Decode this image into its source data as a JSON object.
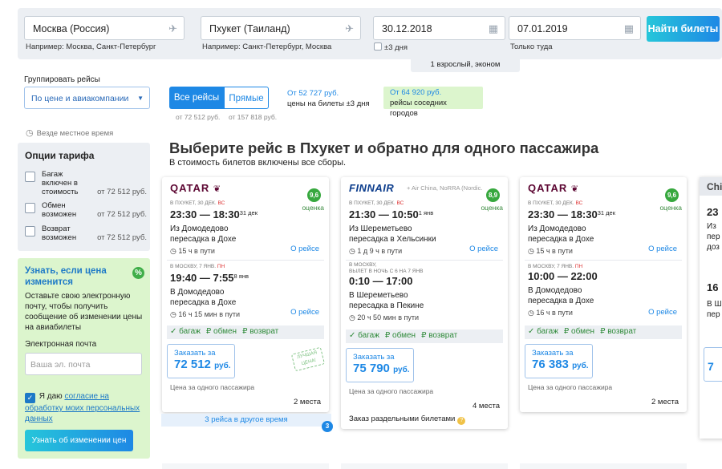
{
  "search": {
    "origin": "Москва (Россия)",
    "origin_hint": "Например: Москва, Санкт-Петербург",
    "destination": "Пхукет (Таиланд)",
    "destination_hint": "Например: Санкт-Петербург, Москва",
    "depart_date": "30.12.2018",
    "flex_label": "±3 дня",
    "return_date": "07.01.2019",
    "return_hint": "Только туда",
    "find_button": "Найти билеты",
    "passengers": "1 взрослый, эконом"
  },
  "left": {
    "group_label": "Группировать рейсы",
    "group_value": "По цене и авиакомпании",
    "local_time": "Везде местное время",
    "tariff_title": "Опции тарифа",
    "tariff_options": [
      {
        "label": "Багаж включен в стоимость",
        "price": "от 72 512 руб."
      },
      {
        "label": "Обмен возможен",
        "price": "от 72 512 руб."
      },
      {
        "label": "Возврат возможен",
        "price": "от 72 512 руб."
      }
    ],
    "notify_title": "Узнать, если цена изменится",
    "notify_badge": "%",
    "notify_text": "Оставьте свою электронную почту, чтобы получить сообщение об изменении цены на авиабилеты",
    "email_label": "Электронная почта",
    "email_placeholder": "Ваша эл. почта",
    "agree_prefix": "Я даю",
    "agree_link": "согласие на обработку моих персональных данных",
    "notify_button": "Узнать об изменении цен"
  },
  "filters": {
    "all_label": "Все рейсы",
    "direct_label": "Прямые",
    "all_price": "от 72 512 руб.",
    "direct_price": "от 157 818 руб.",
    "flex_price": "От 52 727 руб.",
    "flex_text": "цены на билеты ±3 дня",
    "nearby_price": "От 64 920 руб.",
    "nearby_text": "рейсы соседних городов"
  },
  "headline": "Выберите рейс в Пхукет и обратно для одного пассажира",
  "subline": "В стоимость билетов включены все сборы.",
  "perks": {
    "baggage": "✓ багаж",
    "exchange": "₽ обмен",
    "refund": "₽ возврат"
  },
  "order_label": "Заказать за",
  "per_pax": "Цена за одного пассажира",
  "about": "О рейсе",
  "score_label": "оценка",
  "best_price_stamp": "ЛУЧШАЯ ЦЕНА!",
  "more_flights": "3 рейса в другое время",
  "more_count": "3",
  "cards": [
    {
      "airline": "QATAR",
      "extra": "",
      "score": "9,6",
      "out": {
        "dir": "В Пхукет, 30 дек.",
        "dow": "ВС",
        "times": "23:30 — 18:30",
        "next": "31 дек",
        "from": "Из Домодедово",
        "via": "пересадка в Дохе",
        "dur": "15 ч в пути"
      },
      "back": {
        "dir": "В Москву, 7 янв.",
        "dow": "ПН",
        "times": "19:40 — 7:55",
        "next": "8 янв",
        "from": "В Домодедово",
        "via": "пересадка в Дохе",
        "dur": "16 ч 15 мин в пути"
      },
      "price": "72 512",
      "currency": "руб.",
      "places": "2 места"
    },
    {
      "airline": "FINNAIR",
      "extra": "+ Air China, NoRRA (Nordic...",
      "score": "8,9",
      "out": {
        "dir": "В Пхукет, 30 дек.",
        "dow": "ВС",
        "times": "21:30 — 10:50",
        "next": "1 янв",
        "from": "Из Шереметьево",
        "via": "пересадка в Хельсинки",
        "dur": "1 д 9 ч в пути"
      },
      "back": {
        "dir": "В Москву,",
        "dir2": "вылет в ночь с 6 на 7 янв",
        "dow": "",
        "times": "0:10 — 17:00",
        "next": "",
        "from": "В Шереметьево",
        "via": "пересадка в Пекине",
        "dur": "20 ч 50 мин в пути"
      },
      "price": "75 790",
      "currency": "руб.",
      "places": "4 места",
      "separate": "Заказ раздельными билетами"
    },
    {
      "airline": "QATAR",
      "extra": "",
      "score": "9,6",
      "out": {
        "dir": "В Пхукет, 30 дек.",
        "dow": "ВС",
        "times": "23:30 — 18:30",
        "next": "31 дек",
        "from": "Из Домодедово",
        "via": "пересадка в Дохе",
        "dur": "15 ч в пути"
      },
      "back": {
        "dir": "В Москву, 7 янв.",
        "dow": "ПН",
        "times": "10:00 — 22:00",
        "next": "",
        "from": "В Домодедово",
        "via": "пересадка в Дохе",
        "dur": "16 ч в пути"
      },
      "price": "76 383",
      "currency": "руб.",
      "places": "2 места"
    }
  ],
  "card4": {
    "airline": "Chi",
    "t1": "23",
    "s1": "Из",
    "s2": "пер",
    "s3": "доз",
    "t2": "16",
    "s4": "В Ш",
    "s5": "пер",
    "price": "7"
  },
  "colors": {
    "accent": "#1e88e5",
    "green": "#37a83e",
    "panel": "#eceff3",
    "promo": "#dcf5cd"
  }
}
